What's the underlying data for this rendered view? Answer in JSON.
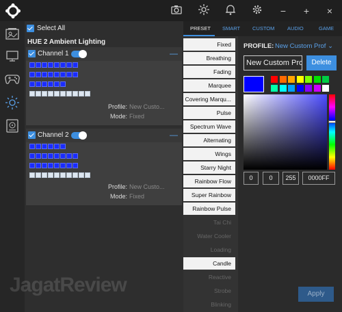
{
  "titlebar": {
    "icons": [
      "logo-icon",
      "camera-icon",
      "sun-icon",
      "bell-icon",
      "gear-icon",
      "minimize-icon",
      "maximize-icon",
      "close-icon"
    ]
  },
  "sidebar": {
    "items": [
      "device-icon",
      "display-icon",
      "gamepad-icon",
      "lighting-icon",
      "storage-icon"
    ],
    "active": "lighting-icon"
  },
  "main": {
    "select_all": "Select All",
    "device_title": "HUE 2 Ambient Lighting",
    "channels": [
      {
        "name": "Channel 1",
        "profile_label": "Profile:",
        "profile_value": "New Custo...",
        "mode_label": "Mode:",
        "mode_value": "Fixed",
        "led_rows": [
          8,
          8,
          6
        ],
        "off_leds": 10
      },
      {
        "name": "Channel 2",
        "profile_label": "Profile:",
        "profile_value": "New Custo...",
        "mode_label": "Mode:",
        "mode_value": "Fixed",
        "led_rows": [
          6,
          8,
          8
        ],
        "off_leds": 10
      }
    ]
  },
  "tabs": [
    "PRESET",
    "SMART",
    "CUSTOM",
    "AUDIO",
    "GAME"
  ],
  "active_tab": "PRESET",
  "effects": [
    {
      "label": "Fixed",
      "state": "on"
    },
    {
      "label": "Breathing",
      "state": "on"
    },
    {
      "label": "Fading",
      "state": "on"
    },
    {
      "label": "Marquee",
      "state": "on"
    },
    {
      "label": "Covering Marqu...",
      "state": "on"
    },
    {
      "label": "Pulse",
      "state": "on"
    },
    {
      "label": "Spectrum Wave",
      "state": "on"
    },
    {
      "label": "Alternating",
      "state": "on"
    },
    {
      "label": "Wings",
      "state": "on"
    },
    {
      "label": "Starry Night",
      "state": "on"
    },
    {
      "label": "Rainbow Flow",
      "state": "on"
    },
    {
      "label": "Super Rainbow",
      "state": "on"
    },
    {
      "label": "Rainbow Pulse",
      "state": "on"
    },
    {
      "label": "Tai Chi",
      "state": "dis"
    },
    {
      "label": "Water Cooler",
      "state": "dis"
    },
    {
      "label": "Loading",
      "state": "dis"
    },
    {
      "label": "Candle",
      "state": "on"
    },
    {
      "label": "Reactive",
      "state": "dis"
    },
    {
      "label": "Strobe",
      "state": "dis"
    },
    {
      "label": "Blinking",
      "state": "dis"
    }
  ],
  "profile": {
    "label": "PROFILE:",
    "value": "New Custom Prof"
  },
  "name_input_value": "New Custom Pro",
  "delete_label": "Delete",
  "current_color": "#0000FF",
  "swatches_row1": [
    "#ff0000",
    "#ff6a00",
    "#ffa500",
    "#ffff00",
    "#7fff00",
    "#00e000",
    "#00cc44"
  ],
  "swatches_row2": [
    "#00ffaa",
    "#00ffff",
    "#00a0ff",
    "#0000ff",
    "#8800ff",
    "#cc00ff",
    "#ffffff"
  ],
  "rgb": {
    "r": "0",
    "g": "0",
    "b": "255",
    "hex": "0000FF"
  },
  "apply_label": "Apply",
  "watermark": "JagatReview"
}
